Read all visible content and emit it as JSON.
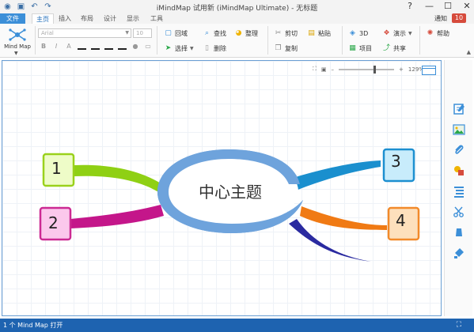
{
  "window": {
    "title": "iMindMap 试用新 (iMindMap Ultimate) - 无标题",
    "help_btn": "?",
    "min_btn": "—",
    "max_btn": "☐",
    "close_btn": "✕"
  },
  "tabs": {
    "file": "文件",
    "items": [
      "主页",
      "插入",
      "布局",
      "设计",
      "显示",
      "工具"
    ],
    "active_index": 0
  },
  "notify": {
    "label": "通知",
    "count": "10"
  },
  "ribbon": {
    "mindmap_label": "Mind Map",
    "font_name": "Arial",
    "font_size": "10",
    "groups": {
      "boundary": "回域",
      "select": "选择",
      "find": "查找",
      "delete": "删除",
      "tidy": "整理",
      "cut": "剪切",
      "copy": "复制",
      "paste": "粘贴",
      "view3d": "3D",
      "project": "项目",
      "present": "演示",
      "share": "共享",
      "help": "帮助"
    }
  },
  "zoom": {
    "level": "129%"
  },
  "map": {
    "central_topic": "中心主题",
    "branches": [
      {
        "label": "1",
        "color": "#8fd014",
        "fill": "#eefcc8",
        "border": "#9ad11b"
      },
      {
        "label": "2",
        "color": "#c4168a",
        "fill": "#fbc8ec",
        "border": "#cc2a93"
      },
      {
        "label": "3",
        "color": "#1a8fce",
        "fill": "#c8ecfb",
        "border": "#1d8fd0"
      },
      {
        "label": "4",
        "color": "#f07a14",
        "fill": "#fde0bc",
        "border": "#f28a2a"
      }
    ],
    "extra_branch_color": "#2a2aa0",
    "central_ring_color": "#6ea3dc"
  },
  "sidebar": {
    "icons": [
      "notes-icon",
      "image-icon",
      "attachment-icon",
      "shapes-icon",
      "outline-icon",
      "scissors-icon",
      "marker-icon",
      "paint-icon"
    ]
  },
  "status": {
    "text": "1 个 Mind Map 打开"
  }
}
